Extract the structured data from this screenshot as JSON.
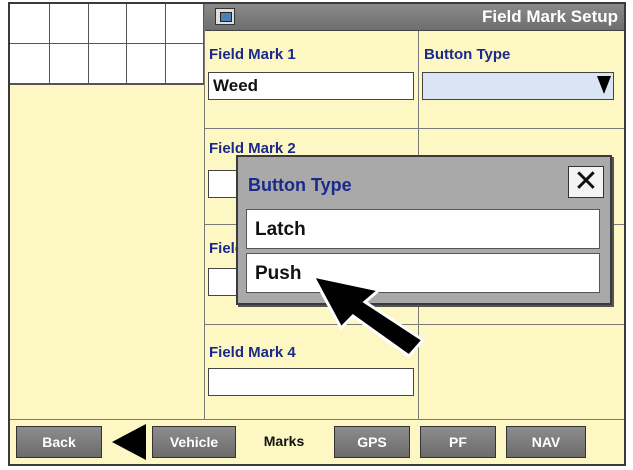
{
  "header": {
    "title": "Field Mark Setup",
    "icon": "document-icon"
  },
  "left_column": {
    "field_marks": [
      {
        "label": "Field Mark 1",
        "value": "Weed"
      },
      {
        "label": "Field Mark 2",
        "value": ""
      },
      {
        "label": "Field Mark 3",
        "value": ""
      },
      {
        "label": "Field Mark 4",
        "value": ""
      }
    ]
  },
  "right_column": {
    "label": "Button Type",
    "value": ""
  },
  "popup": {
    "title": "Button Type",
    "close_label": "✕",
    "options": [
      "Latch",
      "Push"
    ]
  },
  "tabs": {
    "back": "Back",
    "vehicle": "Vehicle",
    "marks": "Marks",
    "gps": "GPS",
    "pf": "PF",
    "nav": "NAV"
  },
  "colors": {
    "background": "#fdf7c3",
    "label_text": "#1a2a8c",
    "header": "#7a7a7a",
    "tab": "#7a7a7a"
  }
}
